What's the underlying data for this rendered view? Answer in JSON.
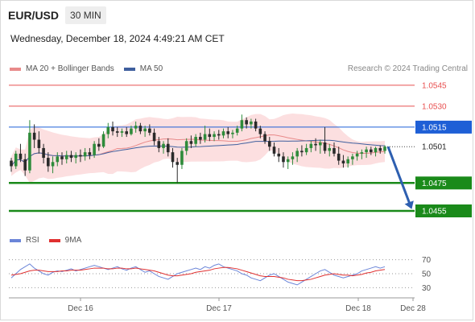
{
  "header": {
    "symbol": "EUR/USD",
    "timeframe": "30 MIN",
    "datetime": "Wednesday, December 18, 2024 4:49:21 AM CET"
  },
  "legend": {
    "ma20_label": "MA 20 + Bollinger Bands",
    "ma50_label": "MA 50",
    "credit": "Research © 2024 Trading Central",
    "rsi_label": "RSI",
    "rsi_ma_label": "9MA"
  },
  "colors": {
    "up": "#2e8b3a",
    "down": "#2a2a2a",
    "ma20": "#e88a8a",
    "band_fill": "#fbd9da",
    "ma50": "#3f5f9e",
    "red_level": "#e85050",
    "green_level": "#1a8a1a",
    "blue_level": "#1e5fd6",
    "rsi": "#6b85d8",
    "rsi_ma": "#e03030",
    "arrow": "#2e5fb0"
  },
  "chart_data": [
    {
      "type": "candlestick",
      "title": "EUR/USD",
      "timeframe": "30 MIN",
      "x_ticks": [
        "Dec 16",
        "Dec 17",
        "Dec 18",
        "Dec 28"
      ],
      "ylim": [
        1.0455,
        1.0553
      ],
      "levels": [
        {
          "label": "1.0545",
          "value": 1.0545,
          "kind": "resistance"
        },
        {
          "label": "1.0530",
          "value": 1.053,
          "kind": "resistance"
        },
        {
          "label": "1.0515",
          "value": 1.0515,
          "kind": "pivot"
        },
        {
          "label": "1.0501",
          "value": 1.0501,
          "kind": "last_price"
        },
        {
          "label": "1.0475",
          "value": 1.0475,
          "kind": "support"
        },
        {
          "label": "1.0455",
          "value": 1.0455,
          "kind": "support"
        }
      ],
      "candles": [
        [
          1.0491,
          1.0493,
          1.0483,
          1.0487
        ],
        [
          1.0487,
          1.0498,
          1.0485,
          1.0496
        ],
        [
          1.0496,
          1.0503,
          1.049,
          1.0492
        ],
        [
          1.0492,
          1.0496,
          1.048,
          1.0484
        ],
        [
          1.0484,
          1.052,
          1.0482,
          1.0511
        ],
        [
          1.0511,
          1.0517,
          1.05,
          1.0506
        ],
        [
          1.0506,
          1.0512,
          1.0496,
          1.05
        ],
        [
          1.05,
          1.0503,
          1.0489,
          1.0493
        ],
        [
          1.0493,
          1.0497,
          1.0483,
          1.0487
        ],
        [
          1.0487,
          1.0494,
          1.0482,
          1.049
        ],
        [
          1.049,
          1.0497,
          1.0487,
          1.0494
        ],
        [
          1.0494,
          1.0497,
          1.0488,
          1.0492
        ],
        [
          1.0492,
          1.0498,
          1.0489,
          1.0495
        ],
        [
          1.0495,
          1.0498,
          1.049,
          1.0493
        ],
        [
          1.0493,
          1.0497,
          1.0489,
          1.0495
        ],
        [
          1.0495,
          1.0499,
          1.049,
          1.0494
        ],
        [
          1.0494,
          1.05,
          1.0491,
          1.0497
        ],
        [
          1.0497,
          1.05,
          1.0492,
          1.0495
        ],
        [
          1.0495,
          1.0505,
          1.0493,
          1.0503
        ],
        [
          1.0503,
          1.0507,
          1.0498,
          1.0501
        ],
        [
          1.0501,
          1.0512,
          1.05,
          1.051
        ],
        [
          1.051,
          1.0518,
          1.0507,
          1.0515
        ],
        [
          1.0515,
          1.0519,
          1.0509,
          1.0512
        ],
        [
          1.0512,
          1.0515,
          1.0508,
          1.0511
        ],
        [
          1.0511,
          1.0514,
          1.0508,
          1.0512
        ],
        [
          1.0512,
          1.0515,
          1.0508,
          1.051
        ],
        [
          1.051,
          1.0516,
          1.0509,
          1.0514
        ],
        [
          1.0514,
          1.0519,
          1.0511,
          1.0516
        ],
        [
          1.0516,
          1.0518,
          1.051,
          1.0512
        ],
        [
          1.0512,
          1.0516,
          1.0508,
          1.0514
        ],
        [
          1.0514,
          1.0517,
          1.0509,
          1.0511
        ],
        [
          1.0511,
          1.0514,
          1.0502,
          1.0505
        ],
        [
          1.0505,
          1.0508,
          1.0497,
          1.05
        ],
        [
          1.05,
          1.0505,
          1.0496,
          1.0503
        ],
        [
          1.0503,
          1.0507,
          1.0494,
          1.0497
        ],
        [
          1.0497,
          1.05,
          1.0486,
          1.049
        ],
        [
          1.049,
          1.0493,
          1.0475,
          1.0488
        ],
        [
          1.0488,
          1.05,
          1.0485,
          1.0498
        ],
        [
          1.0498,
          1.0507,
          1.0495,
          1.0505
        ],
        [
          1.0505,
          1.0509,
          1.05,
          1.0503
        ],
        [
          1.0503,
          1.051,
          1.0501,
          1.0508
        ],
        [
          1.0508,
          1.0511,
          1.0503,
          1.0506
        ],
        [
          1.0506,
          1.0516,
          1.0504,
          1.051
        ],
        [
          1.051,
          1.0514,
          1.0505,
          1.0508
        ],
        [
          1.0508,
          1.0512,
          1.0505,
          1.051
        ],
        [
          1.051,
          1.0513,
          1.0506,
          1.0509
        ],
        [
          1.0509,
          1.0514,
          1.0507,
          1.0512
        ],
        [
          1.0512,
          1.0515,
          1.0507,
          1.051
        ],
        [
          1.051,
          1.0513,
          1.0507,
          1.0511
        ],
        [
          1.0511,
          1.0516,
          1.0509,
          1.0514
        ],
        [
          1.0514,
          1.0524,
          1.0512,
          1.052
        ],
        [
          1.052,
          1.0522,
          1.0514,
          1.0517
        ],
        [
          1.0517,
          1.0521,
          1.0514,
          1.0519
        ],
        [
          1.0519,
          1.0521,
          1.0512,
          1.0514
        ],
        [
          1.0514,
          1.0516,
          1.0507,
          1.051
        ],
        [
          1.051,
          1.0512,
          1.0503,
          1.0505
        ],
        [
          1.0505,
          1.0508,
          1.0498,
          1.0501
        ],
        [
          1.0501,
          1.0504,
          1.0494,
          1.0496
        ],
        [
          1.0496,
          1.05,
          1.049,
          1.0494
        ],
        [
          1.0494,
          1.0497,
          1.0486,
          1.049
        ],
        [
          1.049,
          1.0494,
          1.0485,
          1.0492
        ],
        [
          1.0492,
          1.0497,
          1.0488,
          1.0494
        ],
        [
          1.0494,
          1.05,
          1.049,
          1.0498
        ],
        [
          1.0498,
          1.0502,
          1.0494,
          1.0497
        ],
        [
          1.0497,
          1.0503,
          1.0495,
          1.05
        ],
        [
          1.05,
          1.0505,
          1.0497,
          1.0503
        ],
        [
          1.0503,
          1.0507,
          1.0498,
          1.0502
        ],
        [
          1.0502,
          1.0506,
          1.0496,
          1.0504
        ],
        [
          1.0504,
          1.0515,
          1.0496,
          1.0498
        ],
        [
          1.0498,
          1.0503,
          1.0494,
          1.05
        ],
        [
          1.05,
          1.0504,
          1.0494,
          1.0496
        ],
        [
          1.0496,
          1.0501,
          1.0488,
          1.0491
        ],
        [
          1.0491,
          1.0495,
          1.0486,
          1.0489
        ],
        [
          1.0489,
          1.0494,
          1.0486,
          1.0492
        ],
        [
          1.0492,
          1.0496,
          1.0488,
          1.0494
        ],
        [
          1.0494,
          1.0498,
          1.0491,
          1.0496
        ],
        [
          1.0496,
          1.0499,
          1.0492,
          1.0497
        ],
        [
          1.0497,
          1.0501,
          1.0493,
          1.0499
        ],
        [
          1.0499,
          1.0501,
          1.0495,
          1.0497
        ],
        [
          1.0497,
          1.0501,
          1.0494,
          1.05
        ],
        [
          1.05,
          1.0502,
          1.0496,
          1.0498
        ],
        [
          1.0498,
          1.0502,
          1.0496,
          1.0501
        ]
      ],
      "ma50_note": "MA 50 line drawn across the price chart",
      "forecast": {
        "from": 1.0501,
        "to": 1.0455
      }
    },
    {
      "type": "line",
      "title": "RSI",
      "yticks": [
        70,
        50,
        30
      ],
      "ylim": [
        20,
        80
      ],
      "series": [
        {
          "name": "RSI",
          "values": [
            44,
            50,
            56,
            60,
            64,
            58,
            54,
            50,
            48,
            52,
            54,
            53,
            55,
            57,
            54,
            56,
            58,
            60,
            62,
            60,
            58,
            56,
            58,
            60,
            57,
            55,
            58,
            60,
            56,
            52,
            54,
            50,
            46,
            44,
            42,
            46,
            50,
            52,
            54,
            56,
            58,
            56,
            60,
            58,
            62,
            64,
            60,
            58,
            56,
            54,
            50,
            48,
            44,
            42,
            40,
            44,
            48,
            50,
            46,
            42,
            38,
            36,
            34,
            38,
            42,
            46,
            50,
            54,
            56,
            52,
            48,
            46,
            44,
            46,
            48,
            50,
            54,
            56,
            58,
            60,
            58,
            60
          ]
        },
        {
          "name": "9MA",
          "values": [
            48,
            49,
            50,
            52,
            54,
            55,
            55,
            54,
            53,
            53,
            53,
            54,
            54,
            55,
            55,
            55,
            56,
            57,
            58,
            58,
            58,
            57,
            57,
            58,
            58,
            57,
            57,
            58,
            57,
            56,
            55,
            54,
            52,
            50,
            48,
            47,
            47,
            48,
            49,
            50,
            52,
            53,
            54,
            55,
            57,
            58,
            59,
            59,
            58,
            57,
            55,
            53,
            51,
            49,
            47,
            46,
            46,
            46,
            45,
            44,
            42,
            41,
            40,
            40,
            41,
            42,
            44,
            46,
            48,
            49,
            50,
            49,
            48,
            48,
            47,
            48,
            49,
            51,
            52,
            54,
            55,
            56
          ]
        }
      ]
    }
  ]
}
